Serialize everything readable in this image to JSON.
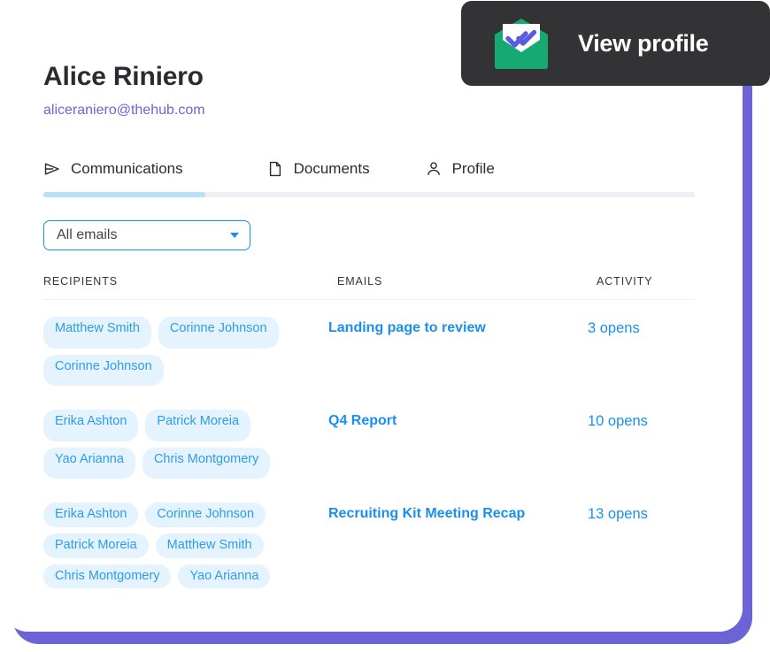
{
  "tooltip": {
    "label": "View profile",
    "icon": "mail-read-icon",
    "background_color": "#333335",
    "icon_envelope_color": "#16a974",
    "icon_check_color": "#5b5be0"
  },
  "card": {
    "backdrop_color": "#6c63d6",
    "background_color": "#ffffff"
  },
  "header": {
    "name": "Alice Riniero",
    "email": "aliceraniero@thehub.com",
    "email_color": "#6c63d6"
  },
  "tabs": {
    "active": "Communications",
    "active_underline_color": "#b7e1f7",
    "items": [
      {
        "label": "Communications",
        "icon": "paper-plane-icon"
      },
      {
        "label": "Documents",
        "icon": "document-icon"
      },
      {
        "label": "Profile",
        "icon": "person-icon"
      }
    ]
  },
  "filter": {
    "label": "All emails",
    "placeholder": "All emails",
    "icon": "chevron-down-icon",
    "border_color": "#1a8ff0"
  },
  "table": {
    "columns": [
      "RECIPIENTS",
      "EMAILS",
      "ACTIVITY"
    ],
    "chip_background_color": "#e4f3fd",
    "chip_text_color": "#2d9cf0",
    "link_color": "#1a8ff0",
    "rows": [
      {
        "recipients": [
          "Matthew Smith",
          "Corinne Johnson",
          "Corinne Johnson"
        ],
        "subject": "Landing page to review",
        "activity": "3 opens"
      },
      {
        "recipients": [
          "Erika Ashton",
          "Patrick Moreia",
          "Yao Arianna",
          "Chris Montgomery"
        ],
        "subject": "Q4 Report",
        "activity": "10 opens"
      },
      {
        "recipients": [
          "Erika Ashton",
          "Corinne Johnson",
          "Patrick Moreia",
          "Matthew Smith",
          "Chris Montgomery",
          "Yao Arianna"
        ],
        "subject": "Recruiting Kit Meeting Recap",
        "activity": "13 opens"
      }
    ]
  }
}
